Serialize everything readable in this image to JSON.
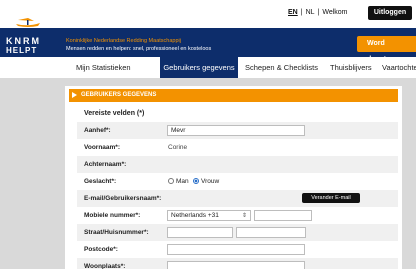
{
  "topbar": {
    "lang_en": "EN",
    "sep1": "|",
    "lang_nl": "NL",
    "sep2": "|",
    "welcome": "Welkom",
    "logout_label": "Uitloggen"
  },
  "header": {
    "logo_line1": "KNRM",
    "logo_line2": "HELPT",
    "tagline1": "Koninklijke Nederlandse Redding Maatschappij",
    "tagline2": "Mensen redden en helpen: snel, professioneel en kosteloos",
    "donate_label": "Word donateur"
  },
  "nav": {
    "items": [
      {
        "label": "Mijn Statistieken"
      },
      {
        "label": "Gebruikers gegevens",
        "active": true
      },
      {
        "label": "Schepen & Checklists"
      },
      {
        "label": "Thuisblijvers"
      },
      {
        "label": "Vaartochte"
      }
    ]
  },
  "form": {
    "section_title": "GEBRUIKERS GEGEVENS",
    "required_title": "Vereiste velden (*)",
    "aanhef_label": "Aanhef*:",
    "aanhef_value": "Mevr",
    "voornaam_label": "Voornaam*:",
    "voornaam_value": "Corine",
    "achternaam_label": "Achternaam*:",
    "geslacht_label": "Geslacht*:",
    "gender_man": "Man",
    "gender_vrouw": "Vrouw",
    "gender_selected": "Vrouw",
    "email_label": "E-mail/Gebruikersnaam*:",
    "change_email_label": "Verander E-mail",
    "mobile_label": "Mobiele nummer*:",
    "country_code": "Netherlands +31",
    "street_label": "Straat/Huisnummer*:",
    "postcode_label": "Postcode*:",
    "woonplaats_label": "Woonplaats*:"
  },
  "colors": {
    "navy": "#0d2d6b",
    "orange": "#f39200",
    "radio_blue": "#2a6fc9"
  }
}
